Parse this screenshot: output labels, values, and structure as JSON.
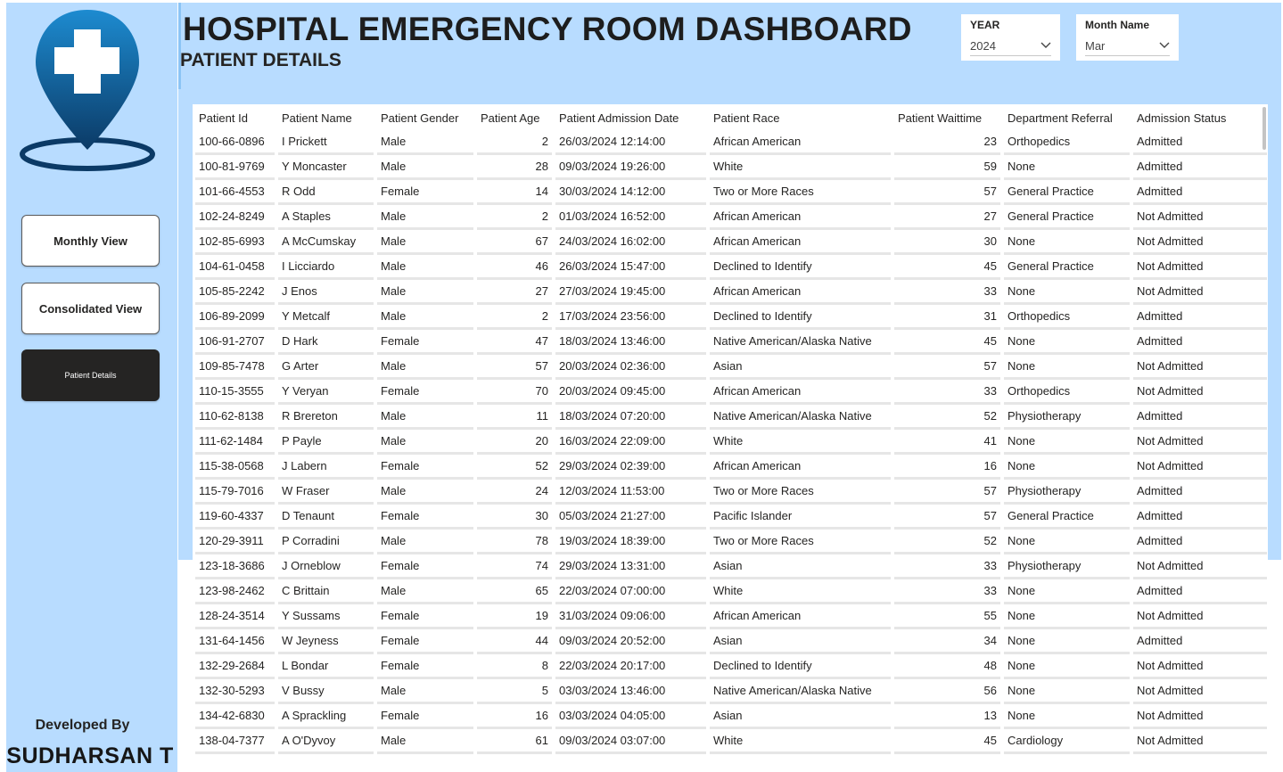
{
  "header": {
    "title": "HOSPITAL EMERGENCY ROOM DASHBOARD",
    "subtitle": "PATIENT DETAILS"
  },
  "filters": {
    "year": {
      "label": "YEAR",
      "value": "2024"
    },
    "month": {
      "label": "Month Name",
      "value": "Mar"
    }
  },
  "nav": {
    "monthly": "Monthly View",
    "consolidated": "Consolidated View",
    "patient_details": "Patient Details"
  },
  "footer": {
    "developed_by": "Developed By",
    "developer": "SUDHARSAN T"
  },
  "colors": {
    "panel": "#b8dcff",
    "logo_dark": "#0b3a66",
    "logo_light": "#1d8bd0",
    "active_button": "#252423"
  },
  "table": {
    "columns": [
      "Patient Id",
      "Patient Name",
      "Patient Gender",
      "Patient Age",
      "Patient Admission Date",
      "Patient Race",
      "Patient Waittime",
      "Department Referral",
      "Admission Status"
    ],
    "rows": [
      [
        "100-66-0896",
        "I Prickett",
        "Male",
        "2",
        "26/03/2024 12:14:00",
        "African American",
        "23",
        "Orthopedics",
        "Admitted"
      ],
      [
        "100-81-9769",
        "Y Moncaster",
        "Male",
        "28",
        "09/03/2024 19:26:00",
        "White",
        "59",
        "None",
        "Admitted"
      ],
      [
        "101-66-4553",
        "R Odd",
        "Female",
        "14",
        "30/03/2024 14:12:00",
        "Two or More Races",
        "57",
        "General Practice",
        "Admitted"
      ],
      [
        "102-24-8249",
        "A Staples",
        "Male",
        "2",
        "01/03/2024 16:52:00",
        "African American",
        "27",
        "General Practice",
        "Not Admitted"
      ],
      [
        "102-85-6993",
        "A McCumskay",
        "Male",
        "67",
        "24/03/2024 16:02:00",
        "African American",
        "30",
        "None",
        "Not Admitted"
      ],
      [
        "104-61-0458",
        "I Licciardo",
        "Male",
        "46",
        "26/03/2024 15:47:00",
        "Declined to Identify",
        "45",
        "General Practice",
        "Not Admitted"
      ],
      [
        "105-85-2242",
        "J Enos",
        "Male",
        "27",
        "27/03/2024 19:45:00",
        "African American",
        "33",
        "None",
        "Not Admitted"
      ],
      [
        "106-89-2099",
        "Y Metcalf",
        "Male",
        "2",
        "17/03/2024 23:56:00",
        "Declined to Identify",
        "31",
        "Orthopedics",
        "Admitted"
      ],
      [
        "106-91-2707",
        "D Hark",
        "Female",
        "47",
        "18/03/2024 13:46:00",
        "Native American/Alaska Native",
        "45",
        "None",
        "Admitted"
      ],
      [
        "109-85-7478",
        "G Arter",
        "Male",
        "57",
        "20/03/2024 02:36:00",
        "Asian",
        "57",
        "None",
        "Not Admitted"
      ],
      [
        "110-15-3555",
        "Y Veryan",
        "Female",
        "70",
        "20/03/2024 09:45:00",
        "African American",
        "33",
        "Orthopedics",
        "Not Admitted"
      ],
      [
        "110-62-8138",
        "R Brereton",
        "Male",
        "11",
        "18/03/2024 07:20:00",
        "Native American/Alaska Native",
        "52",
        "Physiotherapy",
        "Admitted"
      ],
      [
        "111-62-1484",
        "P Payle",
        "Male",
        "20",
        "16/03/2024 22:09:00",
        "White",
        "41",
        "None",
        "Not Admitted"
      ],
      [
        "115-38-0568",
        "J Labern",
        "Female",
        "52",
        "29/03/2024 02:39:00",
        "African American",
        "16",
        "None",
        "Not Admitted"
      ],
      [
        "115-79-7016",
        "W Fraser",
        "Male",
        "24",
        "12/03/2024 11:53:00",
        "Two or More Races",
        "57",
        "Physiotherapy",
        "Admitted"
      ],
      [
        "119-60-4337",
        "D Tenaunt",
        "Female",
        "30",
        "05/03/2024 21:27:00",
        "Pacific Islander",
        "57",
        "General Practice",
        "Admitted"
      ],
      [
        "120-29-3911",
        "P Corradini",
        "Male",
        "78",
        "19/03/2024 18:39:00",
        "Two or More Races",
        "52",
        "None",
        "Admitted"
      ],
      [
        "123-18-3686",
        "J Orneblow",
        "Female",
        "74",
        "29/03/2024 13:31:00",
        "Asian",
        "33",
        "Physiotherapy",
        "Not Admitted"
      ],
      [
        "123-98-2462",
        "C Brittain",
        "Male",
        "65",
        "22/03/2024 07:00:00",
        "White",
        "33",
        "None",
        "Admitted"
      ],
      [
        "128-24-3514",
        "Y Sussams",
        "Female",
        "19",
        "31/03/2024 09:06:00",
        "African American",
        "55",
        "None",
        "Not Admitted"
      ],
      [
        "131-64-1456",
        "W Jeyness",
        "Female",
        "44",
        "09/03/2024 20:52:00",
        "Asian",
        "34",
        "None",
        "Admitted"
      ],
      [
        "132-29-2684",
        "L Bondar",
        "Female",
        "8",
        "22/03/2024 20:17:00",
        "Declined to Identify",
        "48",
        "None",
        "Not Admitted"
      ],
      [
        "132-30-5293",
        "V Bussy",
        "Male",
        "5",
        "03/03/2024 13:46:00",
        "Native American/Alaska Native",
        "56",
        "None",
        "Not Admitted"
      ],
      [
        "134-42-6830",
        "A Sprackling",
        "Female",
        "16",
        "03/03/2024 04:05:00",
        "Asian",
        "13",
        "None",
        "Not Admitted"
      ],
      [
        "138-04-7377",
        "A O'Dyvoy",
        "Male",
        "61",
        "09/03/2024 03:07:00",
        "White",
        "45",
        "Cardiology",
        "Not Admitted"
      ]
    ]
  }
}
